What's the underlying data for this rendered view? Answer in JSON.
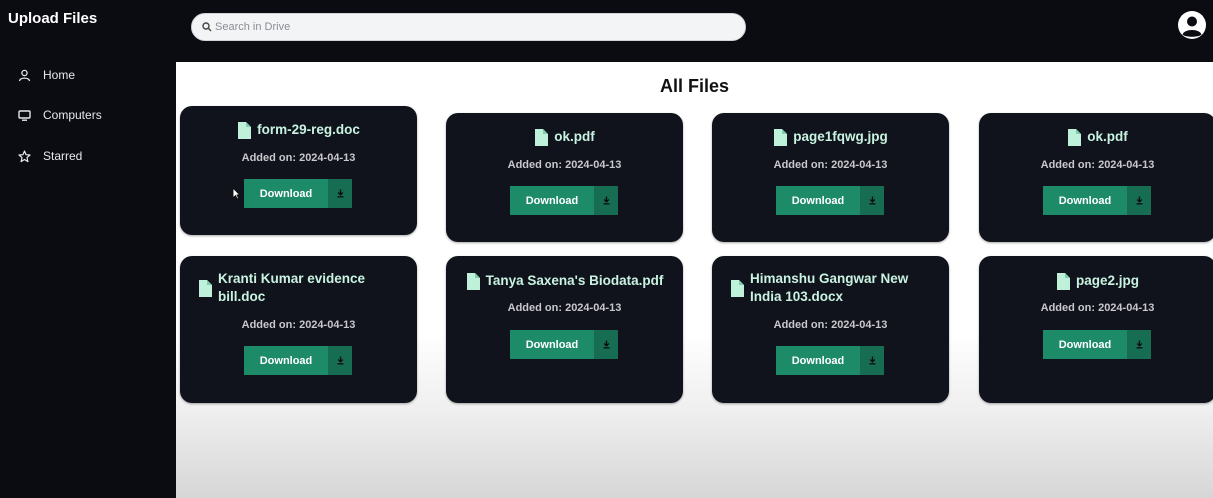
{
  "app": {
    "title": "Upload Files"
  },
  "search": {
    "placeholder": "Search in Drive"
  },
  "sidebar": {
    "items": [
      {
        "label": "Home",
        "icon": "user-icon"
      },
      {
        "label": "Computers",
        "icon": "monitor-icon"
      },
      {
        "label": "Starred",
        "icon": "star-icon"
      }
    ]
  },
  "main": {
    "title": "All Files",
    "download_label": "Download",
    "files": [
      {
        "name": "form-29-reg.doc",
        "added": "Added on: 2024-04-13"
      },
      {
        "name": "ok.pdf",
        "added": "Added on: 2024-04-13"
      },
      {
        "name": "page1fqwg.jpg",
        "added": "Added on: 2024-04-13"
      },
      {
        "name": "ok.pdf",
        "added": "Added on: 2024-04-13"
      },
      {
        "name": "Kranti Kumar evidence bill.doc",
        "added": "Added on: 2024-04-13"
      },
      {
        "name": "Tanya Saxena's Biodata.pdf",
        "added": "Added on: 2024-04-13"
      },
      {
        "name": "Himanshu Gangwar New India 103.docx",
        "added": "Added on: 2024-04-13"
      },
      {
        "name": "page2.jpg",
        "added": "Added on: 2024-04-13"
      }
    ]
  },
  "colors": {
    "background": "#0b0c12",
    "card": "#10131c",
    "file_name": "#c9f3e0",
    "file_icon": "#bff0d9",
    "download_button": "#1d8a68",
    "download_icon_bg": "#166d52"
  }
}
